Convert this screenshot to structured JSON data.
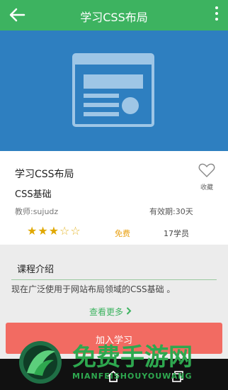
{
  "appbar": {
    "title": "学习CSS布局",
    "back_icon": "arrow-left-icon",
    "menu_icon": "more-vert-icon",
    "color": "#3db360"
  },
  "banner": {
    "color": "#2e7fc0",
    "icon": "web-layout-icon"
  },
  "course": {
    "name": "学习CSS布局",
    "subtitle": "CSS基础",
    "teacher": "教师:sujudz",
    "validity": "有效期:30天",
    "favorite_label": "收藏",
    "rating": 3,
    "rating_max": 5,
    "price": "免费",
    "students": "17学员"
  },
  "intro": {
    "tab_label": "课程介绍",
    "text": "现在广泛使用于网站布局领域的CSS基础 。",
    "more_label": "查看更多"
  },
  "join_button": {
    "label": "加入学习",
    "color": "#f26b62"
  },
  "watermark": {
    "cn": "免费手游网",
    "en": "MIANFEISHOUYOUWANG"
  }
}
